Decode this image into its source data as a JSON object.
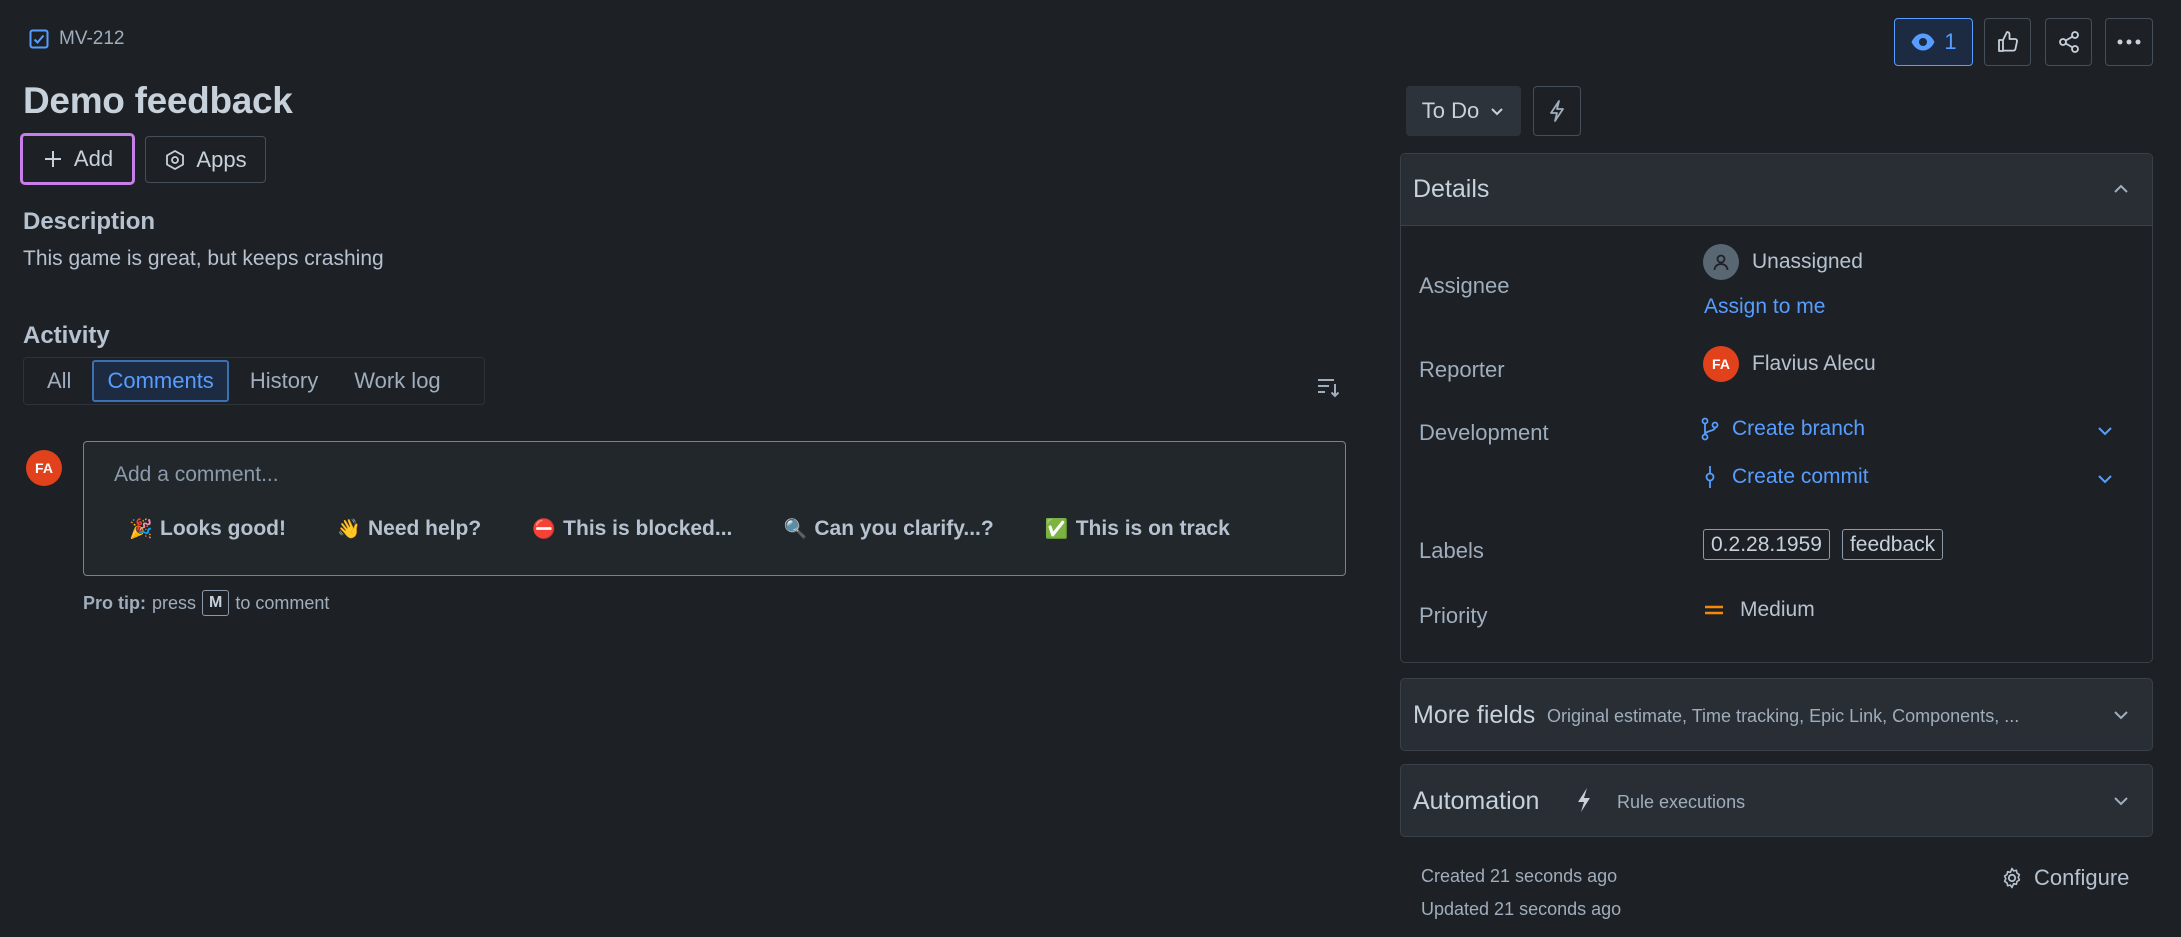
{
  "issue": {
    "key": "MV-212",
    "title": "Demo feedback",
    "add_label": "Add",
    "apps_label": "Apps",
    "description_heading": "Description",
    "description_text": "This game is great, but keeps crashing"
  },
  "activity": {
    "heading": "Activity",
    "tabs": [
      {
        "label": "All",
        "active": false
      },
      {
        "label": "Comments",
        "active": true
      },
      {
        "label": "History",
        "active": false
      },
      {
        "label": "Work log",
        "active": false
      }
    ],
    "comment_avatar_initials": "FA",
    "comment_placeholder": "Add a comment...",
    "quick_replies": [
      {
        "emoji": "🎉",
        "label": "Looks good!"
      },
      {
        "emoji": "👋",
        "label": "Need help?"
      },
      {
        "emoji": "⛔",
        "label": "This is blocked..."
      },
      {
        "emoji": "🔍",
        "label": "Can you clarify...?"
      },
      {
        "emoji": "✅",
        "label": "This is on track"
      }
    ],
    "pro_tip_bold": "Pro tip:",
    "pro_tip_pre": "press",
    "pro_tip_key": "M",
    "pro_tip_post": "to comment"
  },
  "toolbar": {
    "watch_count": "1",
    "status_label": "To Do"
  },
  "details": {
    "title": "Details",
    "assignee_label": "Assignee",
    "assignee_value": "Unassigned",
    "assign_to_me": "Assign to me",
    "reporter_label": "Reporter",
    "reporter_initials": "FA",
    "reporter_name": "Flavius Alecu",
    "development_label": "Development",
    "create_branch": "Create branch",
    "create_commit": "Create commit",
    "labels_label": "Labels",
    "labels": [
      "0.2.28.1959",
      "feedback"
    ],
    "priority_label": "Priority",
    "priority_value": "Medium"
  },
  "more_fields": {
    "title": "More fields",
    "subtitle": "Original estimate, Time tracking, Epic Link, Components, ..."
  },
  "automation": {
    "title": "Automation",
    "subtitle": "Rule executions"
  },
  "footer": {
    "created": "Created 21 seconds ago",
    "updated": "Updated 21 seconds ago",
    "configure": "Configure"
  },
  "colors": {
    "background": "#1d2125",
    "accent": "#579dff",
    "avatar": "#e2421b",
    "priority_medium": "#f68909",
    "focus_ring": "#c77ee9"
  }
}
